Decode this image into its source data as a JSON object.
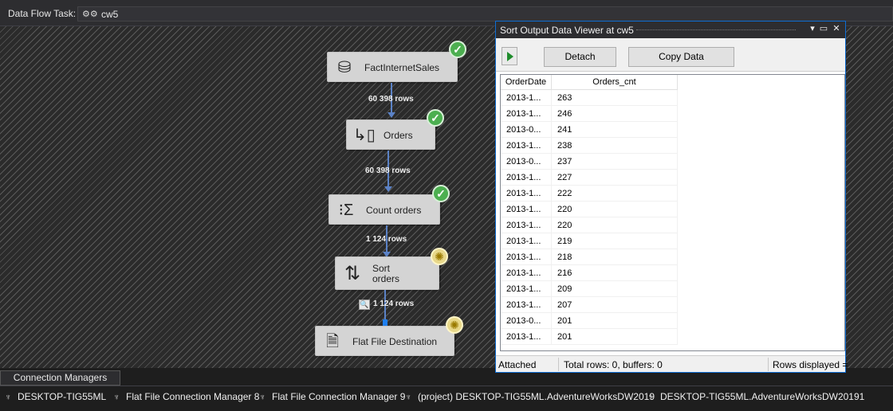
{
  "topbar": {
    "label": "Data Flow Task:",
    "task_name": "cw5"
  },
  "flow": {
    "nodes": [
      {
        "name": "FactInternetSales",
        "status": "success"
      },
      {
        "name": "Orders",
        "status": "success"
      },
      {
        "name": "Count orders",
        "status": "success"
      },
      {
        "name": "Sort\norders",
        "status": "running"
      },
      {
        "name": "Flat File Destination",
        "status": "running"
      }
    ],
    "paths": [
      "60 398 rows",
      "60 398 rows",
      "1 124 rows",
      "1 124 rows"
    ]
  },
  "viewer": {
    "title": "Sort Output Data Viewer at cw5",
    "detach_label": "Detach",
    "copy_label": "Copy Data",
    "columns": [
      "OrderDate",
      "Orders_cnt"
    ],
    "rows": [
      [
        "2013-1...",
        "263"
      ],
      [
        "2013-1...",
        "246"
      ],
      [
        "2013-0...",
        "241"
      ],
      [
        "2013-1...",
        "238"
      ],
      [
        "2013-0...",
        "237"
      ],
      [
        "2013-1...",
        "227"
      ],
      [
        "2013-1...",
        "222"
      ],
      [
        "2013-1...",
        "220"
      ],
      [
        "2013-1...",
        "220"
      ],
      [
        "2013-1...",
        "219"
      ],
      [
        "2013-1...",
        "218"
      ],
      [
        "2013-1...",
        "216"
      ],
      [
        "2013-1...",
        "209"
      ],
      [
        "2013-1...",
        "207"
      ],
      [
        "2013-0...",
        "201"
      ],
      [
        "2013-1...",
        "201"
      ]
    ],
    "status_attached": "Attached",
    "status_total": "Total rows: 0, buffers: 0",
    "status_displayed": "Rows displayed ="
  },
  "connection_managers": {
    "tab_label": "Connection Managers",
    "items": [
      "DESKTOP-TIG55ML",
      "Flat File Connection Manager 8",
      "Flat File Connection Manager 9",
      "(project) DESKTOP-TIG55ML.AdventureWorksDW2019",
      "DESKTOP-TIG55ML.AdventureWorksDW20191"
    ]
  },
  "colors": {
    "success": "#4caf50",
    "running": "#e8d88a",
    "path": "#5b82c6",
    "viewer_border": "#0e6dd3"
  },
  "icons": {
    "source": "database-arrow-icon",
    "conditional_split": "conditional-split-icon",
    "aggregate": "sigma-icon",
    "sort": "sort-arrows-icon",
    "destination": "file-destination-icon"
  }
}
